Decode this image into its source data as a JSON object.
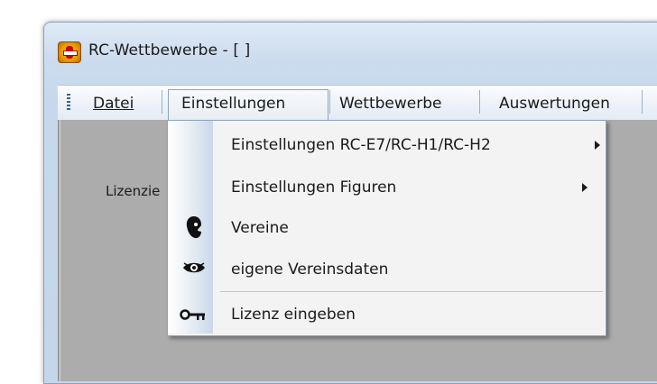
{
  "window": {
    "title": "RC-Wettbewerbe - [ ]"
  },
  "menubar": {
    "items": [
      {
        "label": "Datei",
        "underlined": true
      },
      {
        "label": "Einstellungen",
        "active": true
      },
      {
        "label": "Wettbewerbe"
      },
      {
        "label": "Auswertungen"
      }
    ]
  },
  "content": {
    "label_fragment": "Lizenzie"
  },
  "dropdown": {
    "items": [
      {
        "label": "Einstellungen RC-E7/RC-H1/RC-H2",
        "submenu": true,
        "icon": ""
      },
      {
        "label": "Einstellungen Figuren",
        "submenu": true,
        "icon": ""
      },
      {
        "label": "Vereine",
        "submenu": false,
        "icon": "club-head-icon"
      },
      {
        "label": "eigene Vereinsdaten",
        "submenu": false,
        "icon": "eye-icon"
      },
      {
        "label": "Lizenz eingeben",
        "submenu": false,
        "icon": "key-icon",
        "separator_before": true
      }
    ]
  },
  "colors": {
    "menu_bg": "#eef3f9",
    "mdi_bg": "#acacac",
    "dropdown_bg": "#f3f3f3",
    "border": "#8fa5bd"
  }
}
